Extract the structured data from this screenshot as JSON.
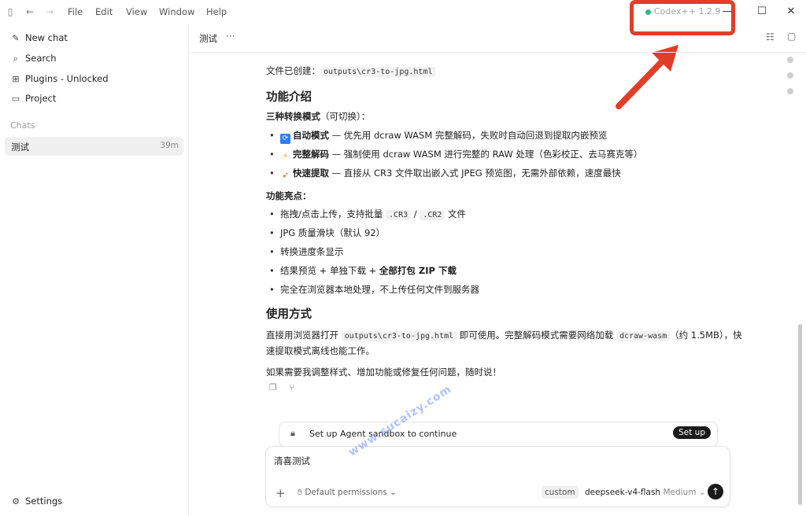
{
  "titlebar": {
    "menus": [
      "File",
      "Edit",
      "View",
      "Window",
      "Help"
    ],
    "badge": "Codex++ 1.2.9",
    "accent_color": "#e23d28",
    "icons": [
      "sidebar-toggle-icon",
      "back-arrow-icon",
      "forward-arrow-icon",
      "minimize-icon",
      "maximize-icon",
      "close-icon"
    ]
  },
  "sidebar": {
    "items": [
      {
        "label": "New chat",
        "icon": "edit-icon"
      },
      {
        "label": "Search",
        "icon": "search-icon"
      },
      {
        "label": "Plugins - Unlocked",
        "icon": "grid-icon"
      },
      {
        "label": "Project",
        "icon": "folder-icon"
      }
    ],
    "chats_heading": "Chats",
    "active_chat": {
      "title": "测试",
      "time": "39m"
    },
    "settings_label": "Settings"
  },
  "header": {
    "title": "测试",
    "more": "···"
  },
  "content": {
    "file_created_label": "文件已创建：",
    "file_created_path": "outputs\\cr3-to-jpg.html",
    "section1_title": "功能介绍",
    "modes_heading": "三种转换模式",
    "modes_heading_suffix": "（可切换）：",
    "modes": [
      {
        "icon": "🔄",
        "icon_bg": "#2d7df6",
        "name": "自动模式",
        "desc": " — 优先用 dcraw WASM 完整解码，失败时自动回退到提取内嵌预览"
      },
      {
        "icon": "⚡",
        "icon_bg": "#ffffff",
        "name": "完整解码",
        "desc": " — 强制使用 dcraw WASM 进行完整的 RAW 处理（色彩校正、去马赛克等）"
      },
      {
        "icon": "🚀",
        "icon_bg": "#ffffff",
        "name": "快速提取",
        "desc": " — 直接从 CR3 文件取出嵌入式 JPEG 预览图，无需外部依赖，速度最快"
      }
    ],
    "highlights_heading": "功能亮点：",
    "highlight1_pre": "拖拽/点击上传，支持批量 ",
    "highlight1_code1": ".CR3",
    "highlight1_sep": " / ",
    "highlight1_code2": ".CR2",
    "highlight1_post": " 文件",
    "highlight2": "JPG 质量滑块（默认 92）",
    "highlight3": "转换进度条显示",
    "highlight4_pre": "结果预览 + 单独下载 + ",
    "highlight4_bold": "全部打包 ZIP 下载",
    "highlight5": "完全在浏览器本地处理，不上传任何文件到服务器",
    "section2_title": "使用方式",
    "usage_pre": "直接用浏览器打开 ",
    "usage_code1": "outputs\\cr3-to-jpg.html",
    "usage_mid": " 即可使用。完整解码模式需要网络加载 ",
    "usage_code2": "dcraw-wasm",
    "usage_post": "（约 1.5MB），快速提取模式离线也能工作。",
    "closing": "如果需要我调整样式、增加功能或修复任何问题，随时说！"
  },
  "sandbox": {
    "text": "Set up Agent sandbox to continue",
    "button": "Set up"
  },
  "composer": {
    "input_value": "清喜测试",
    "permissions_label": "Default permissions",
    "custom_tag": "custom",
    "model": "deepseek-v4-flash",
    "effort": "Medium"
  },
  "watermark": "www.sucaizy.com"
}
